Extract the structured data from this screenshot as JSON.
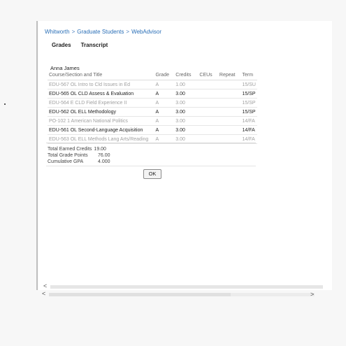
{
  "breadcrumb": {
    "items": [
      "Whitworth",
      "Graduate Students",
      "WebAdvisor"
    ],
    "separator": ">"
  },
  "tabs": [
    "Grades",
    "Transcript"
  ],
  "student_name": "Anna James",
  "table": {
    "headers": [
      "Course/Section and Title",
      "Grade",
      "Credits",
      "CEUs",
      "Repeat",
      "Term"
    ],
    "rows": [
      {
        "title": "EDU-567 OL Intro to Cld Issues in Ed",
        "grade": "A",
        "credits": "1.00",
        "ceus": "",
        "repeat": "",
        "term": "15/SU",
        "style": "faint"
      },
      {
        "title": "EDU-565 OL CLD Assess & Evaluation",
        "grade": "A",
        "credits": "3.00",
        "ceus": "",
        "repeat": "",
        "term": "15/SP",
        "style": "dark"
      },
      {
        "title": "EDU-564 E CLD Field Experience II",
        "grade": "A",
        "credits": "3.00",
        "ceus": "",
        "repeat": "",
        "term": "15/SP",
        "style": "faint"
      },
      {
        "title": "EDU-562 OL ELL Methodology",
        "grade": "A",
        "credits": "3.00",
        "ceus": "",
        "repeat": "",
        "term": "15/SP",
        "style": "dark"
      },
      {
        "title": "PO-102 1 American National Politics",
        "grade": "A",
        "credits": "3.00",
        "ceus": "",
        "repeat": "",
        "term": "14/FA",
        "style": "faint"
      },
      {
        "title": "EDU-561 OL Second-Language Acquisition",
        "grade": "A",
        "credits": "3.00",
        "ceus": "",
        "repeat": "",
        "term": "14/FA",
        "style": "dark"
      },
      {
        "title": "EDU-563 OL ELL Methods Lang Arts/Reading",
        "grade": "A",
        "credits": "3.00",
        "ceus": "",
        "repeat": "",
        "term": "14/FA",
        "style": "faint"
      }
    ]
  },
  "totals": {
    "earned_credits_label": "Total Earned Credits",
    "earned_credits_value": "19.00",
    "grade_points_label": "Total Grade Points",
    "grade_points_value": "76.00",
    "gpa_label": "Cumulative GPA",
    "gpa_value": "4.000"
  },
  "ok_label": "OK",
  "scrollbar": {
    "left_arrow": "<",
    "right_arrow": ">"
  }
}
